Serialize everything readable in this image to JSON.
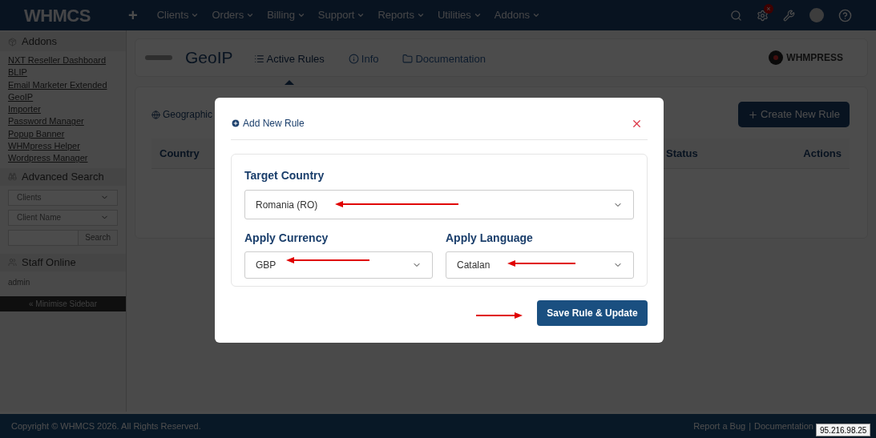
{
  "topbar": {
    "logo": "WHMCS",
    "plus": "+",
    "menu": [
      {
        "label": "Clients"
      },
      {
        "label": "Orders"
      },
      {
        "label": "Billing"
      },
      {
        "label": "Support"
      },
      {
        "label": "Reports"
      },
      {
        "label": "Utilities"
      },
      {
        "label": "Addons"
      }
    ],
    "alert_badge": "×"
  },
  "sidebar": {
    "addons_title": "Addons",
    "addons": [
      "NXT Reseller Dashboard",
      "BLIP",
      "Email Marketer Extended",
      "GeoIP",
      "Importer",
      "Password Manager",
      "Popup Banner",
      "WHMpress Helper",
      "Wordpress Manager"
    ],
    "search_title": "Advanced Search",
    "search_type": "Clients",
    "search_field": "Client Name",
    "search_button": "Search",
    "staff_title": "Staff Online",
    "staff": [
      "admin"
    ],
    "minimise": "« Minimise Sidebar"
  },
  "module": {
    "title": "GeoIP",
    "tabs": [
      {
        "label": "Active Rules",
        "selected": true
      },
      {
        "label": "Info",
        "selected": false
      },
      {
        "label": "Documentation",
        "selected": false
      }
    ],
    "brand": "WHMPRESS"
  },
  "panel": {
    "heading": "Geographic",
    "create_button": "Create New Rule",
    "columns": [
      "Country",
      "Status",
      "Actions"
    ]
  },
  "modal": {
    "title": "Add New Rule",
    "country_label": "Target Country",
    "country_value": "Romania (RO)",
    "currency_label": "Apply Currency",
    "currency_value": "GBP",
    "language_label": "Apply Language",
    "language_value": "Catalan",
    "save_button": "Save Rule & Update"
  },
  "footer": {
    "copyright": "Copyright © WHMCS 2026. All Rights Reserved.",
    "links": [
      "Report a Bug",
      "Documentation"
    ],
    "separator": "|",
    "ip_tooltip": "95.216.98.25"
  }
}
